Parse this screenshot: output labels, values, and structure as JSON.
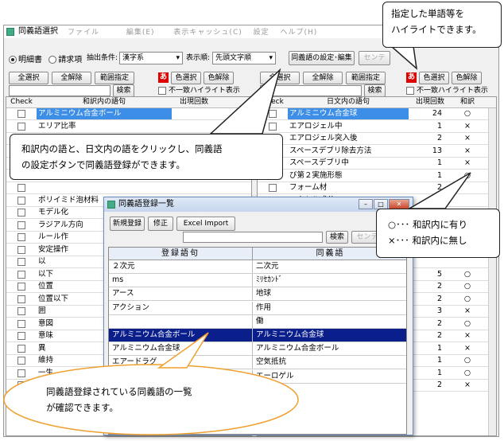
{
  "window": {
    "title": "同義語選択",
    "menu_ghost": "ファイル　　　 編集(E)　　 表示キャッシュ(C)　 設定　 ヘルプ(H)"
  },
  "toolbar": {
    "radio_meisaisho": "明細書",
    "radio_seikyuko": "請求項",
    "extract_label": "抽出条件:",
    "extract_value": "漢字系",
    "order_label": "表示順:",
    "order_value": "先頭文字順",
    "synonym_settings_button": "同義語の設定･編集",
    "center_button": "センテ"
  },
  "left_pane": {
    "select_all": "全選択",
    "clear_all": "全解除",
    "range": "範囲指定",
    "search": "検索",
    "color_select": "色選択",
    "color_clear": "色解除",
    "swatch_glyph": "あ",
    "mismatch_highlight": "不一致ハイライト表示",
    "headers": [
      "Check",
      "和訳内の語句",
      "出現回数"
    ],
    "rows": [
      {
        "term": "アルミニウム合金ボール",
        "count": "",
        "mark": "",
        "selected": true
      },
      {
        "term": "エリア比率",
        "count": "",
        "mark": ""
      },
      {
        "term": "",
        "count": "",
        "mark": ""
      },
      {
        "term": "",
        "count": "",
        "mark": ""
      },
      {
        "term": "",
        "count": "",
        "mark": ""
      },
      {
        "term": "",
        "count": "",
        "mark": ""
      },
      {
        "term": "",
        "count": "",
        "mark": ""
      },
      {
        "term": "ポリイミド泡材料",
        "count": "1",
        "mark": "○"
      },
      {
        "term": "モデル化",
        "count": "",
        "mark": ""
      },
      {
        "term": "ラジアル方向",
        "count": "",
        "mark": ""
      },
      {
        "term": "ルール作",
        "count": "",
        "mark": ""
      },
      {
        "term": "安定操作",
        "count": "",
        "mark": ""
      },
      {
        "term": "以",
        "count": "",
        "mark": ""
      },
      {
        "term": "以下",
        "count": "",
        "mark": ""
      },
      {
        "term": "位置",
        "count": "",
        "mark": ""
      },
      {
        "term": "位置以下",
        "count": "",
        "mark": ""
      },
      {
        "term": "囲",
        "count": "",
        "mark": ""
      },
      {
        "term": "意図",
        "count": "",
        "mark": ""
      },
      {
        "term": "意味",
        "count": "",
        "mark": ""
      },
      {
        "term": "異",
        "count": "",
        "mark": ""
      },
      {
        "term": "維持",
        "count": "",
        "mark": ""
      },
      {
        "term": "一生",
        "count": "",
        "mark": ""
      },
      {
        "term": "一方",
        "count": "",
        "mark": ""
      }
    ]
  },
  "right_pane": {
    "select_all": "全選択",
    "clear_all": "全解除",
    "range": "範囲指定",
    "search": "検索",
    "color_select": "色選択",
    "color_clear": "色解除",
    "swatch_glyph": "あ",
    "mismatch_highlight": "不一致ハイライト表示",
    "headers": [
      "Check",
      "日文内の語句",
      "出現回数",
      "和訳"
    ],
    "rows": [
      {
        "term": "アルミニウム合金球",
        "count": "24",
        "mark": "○",
        "selected": true
      },
      {
        "term": "エアロジェル中",
        "count": "1",
        "mark": "×"
      },
      {
        "term": "エアロジェル突入後",
        "count": "2",
        "mark": "×"
      },
      {
        "term": "スペースデブリ除去方法",
        "count": "13",
        "mark": "×"
      },
      {
        "term": "スペースデブリ中",
        "count": "1",
        "mark": "×"
      },
      {
        "term": "び第２実施形態",
        "count": "1",
        "mark": "○"
      },
      {
        "term": "フォーム材",
        "count": "2",
        "mark": ""
      },
      {
        "term": "ベクトル成分",
        "count": "1",
        "mark": ""
      },
      {
        "term": "",
        "count": "",
        "mark": ""
      },
      {
        "term": "",
        "count": "",
        "mark": ""
      },
      {
        "term": "",
        "count": "",
        "mark": ""
      },
      {
        "term": "",
        "count": "",
        "mark": ""
      },
      {
        "term": "",
        "count": "",
        "mark": ""
      },
      {
        "term": "",
        "count": "5",
        "mark": "○"
      },
      {
        "term": "",
        "count": "2",
        "mark": "○"
      },
      {
        "term": "",
        "count": "2",
        "mark": "○"
      },
      {
        "term": "",
        "count": "3",
        "mark": "×"
      },
      {
        "term": "",
        "count": "2",
        "mark": "○"
      },
      {
        "term": "",
        "count": "2",
        "mark": "×"
      },
      {
        "term": "",
        "count": "1",
        "mark": "×"
      },
      {
        "term": "",
        "count": "1",
        "mark": "○"
      },
      {
        "term": "",
        "count": "1",
        "mark": "○"
      },
      {
        "term": "",
        "count": "2",
        "mark": "×"
      }
    ]
  },
  "dialog": {
    "title": "同義語登録一覧",
    "new_button": "新規登録",
    "edit_button": "修正",
    "import_button": "Excel Import",
    "search_button": "検索",
    "center_button": "センテ",
    "headers": [
      "登録語句",
      "同義語"
    ],
    "rows": [
      {
        "term": "２次元",
        "synonym": "二次元"
      },
      {
        "term": "ms",
        "synonym": "ﾐﾘｾｶﾝﾄﾞ"
      },
      {
        "term": "アース",
        "synonym": "地球"
      },
      {
        "term": "アクション",
        "synonym": "作用"
      },
      {
        "term": "",
        "synonym": "働"
      },
      {
        "term": "アルミニウム合金ボール",
        "synonym": "アルミニウム合金球",
        "selected": true
      },
      {
        "term": "アルミニウム合金球",
        "synonym": "アルミニウム合金ボール"
      },
      {
        "term": "エアードラグ",
        "synonym": "空気抵抗"
      },
      {
        "term": "",
        "synonym": "エーロゲル"
      }
    ]
  },
  "callouts": {
    "top_right": "指定した単語等を\nハイライトできます。",
    "middle": "和訳内の語と、日文内の語をクリックし、同義語\nの設定ボタンで同義語登録ができます。",
    "legend": "○･･･ 和訳内に有り\n×･･･ 和訳内に無し",
    "bottom": "同義語登録されている同義語の一覧\nが確認できます。"
  }
}
